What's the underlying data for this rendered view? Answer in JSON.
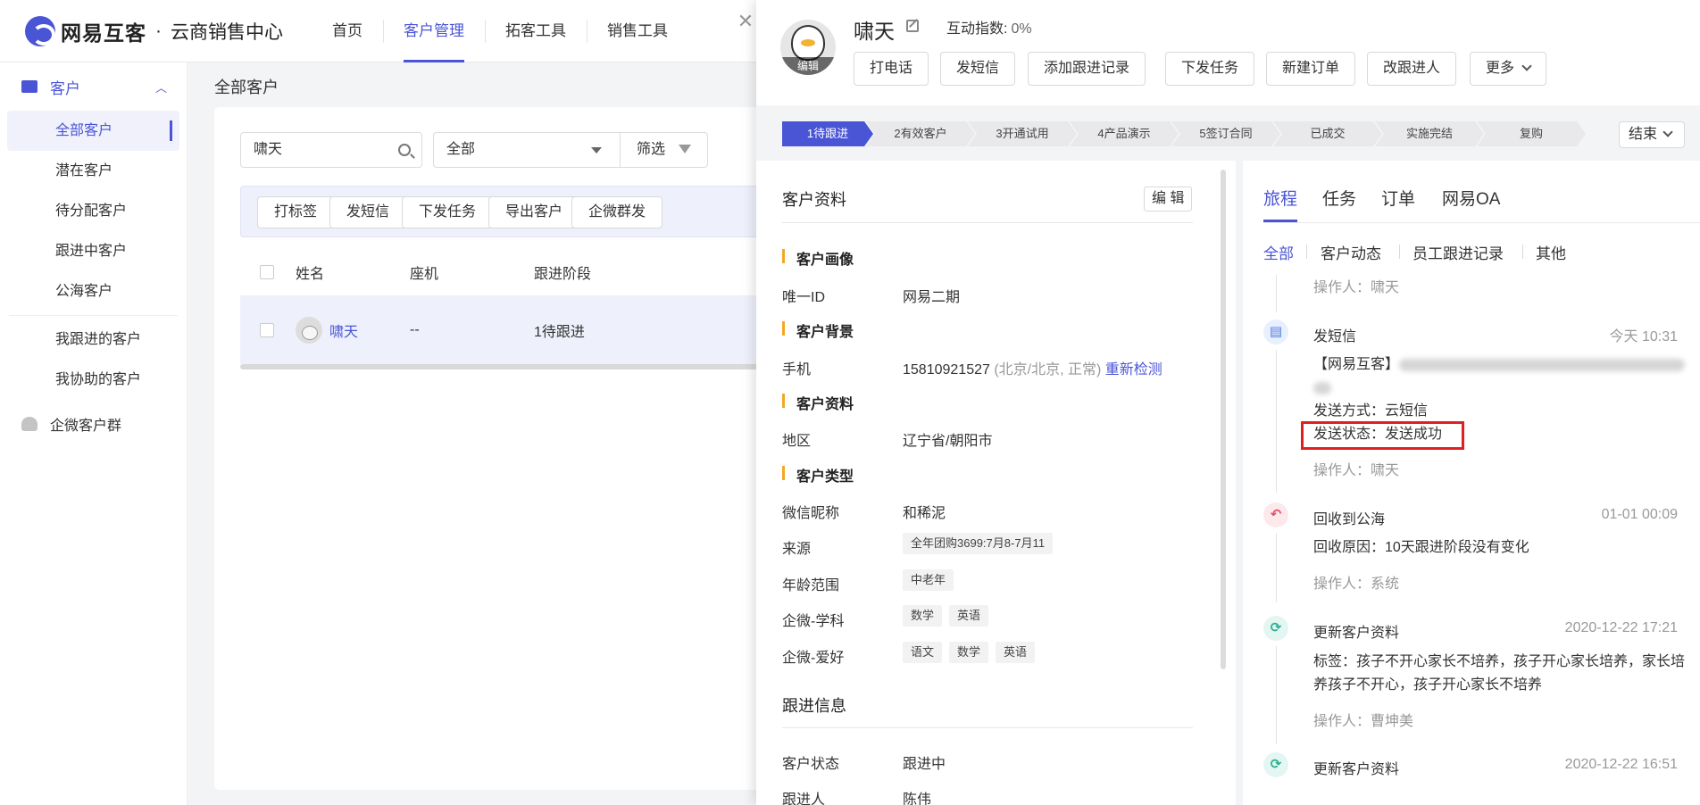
{
  "brand": {
    "name": "网易互客",
    "dot": "·",
    "subtitle": "云商销售中心"
  },
  "topnav": {
    "items": [
      "首页",
      "客户管理",
      "拓客工具",
      "销售工具"
    ],
    "active_index": 1
  },
  "sidebar": {
    "group_label": "客户",
    "items": [
      "全部客户",
      "潜在客户",
      "待分配客户",
      "跟进中客户",
      "公海客户"
    ],
    "items2": [
      "我跟进的客户",
      "我协助的客户"
    ],
    "bottom": "企微客户群",
    "active": "全部客户"
  },
  "main": {
    "breadcrumb": "全部客户",
    "search_value": "啸天",
    "select_value": "全部",
    "filter_label": "筛选",
    "actions": [
      "打标签",
      "发短信",
      "下发任务",
      "导出客户",
      "企微群发"
    ],
    "columns": [
      "姓名",
      "座机",
      "跟进阶段"
    ],
    "row": {
      "name": "啸天",
      "phone": "--",
      "stage": "1待跟进"
    }
  },
  "drawer": {
    "avatar_edit": "编辑",
    "name": "啸天",
    "interaction_label": "互动指数:",
    "interaction_value": "0%",
    "buttons": [
      "打电话",
      "发短信",
      "添加跟进记录",
      "下发任务",
      "新建订单",
      "改跟进人",
      "更多"
    ],
    "stages": [
      "1待跟进",
      "2有效客户",
      "3开通试用",
      "4产品演示",
      "5签订合同",
      "已成交",
      "实施完结",
      "复购"
    ],
    "active_stage": "1待跟进",
    "end_label": "结束"
  },
  "info": {
    "title": "客户资料",
    "edit_label": "编 辑",
    "sections": {
      "portrait": "客户画像",
      "background": "客户背景",
      "profile": "客户资料",
      "type": "客户类型"
    },
    "uid_label": "唯一ID",
    "uid_value": "网易二期",
    "phone_label": "手机",
    "phone_value": "15810921527",
    "phone_extra": "(北京/北京, 正常)",
    "phone_action": "重新检测",
    "region_label": "地区",
    "region_value": "辽宁省/朝阳市",
    "wechat_label": "微信昵称",
    "wechat_value": "和稀泥",
    "source_label": "来源",
    "source_tag": "全年团购3699:7月8-7月11",
    "age_label": "年龄范围",
    "age_tag": "中老年",
    "subject_label": "企微-学科",
    "subject_tags": [
      "数学",
      "英语"
    ],
    "hobby_label": "企微-爱好",
    "hobby_tags": [
      "语文",
      "数学",
      "英语"
    ],
    "follow_title": "跟进信息",
    "status_label": "客户状态",
    "status_value": "跟进中",
    "owner_label": "跟进人",
    "owner_value": "陈伟"
  },
  "timeline": {
    "tabs": [
      "旅程",
      "任务",
      "订单",
      "网易OA"
    ],
    "filters": [
      "全部",
      "客户动态",
      "员工跟进记录",
      "其他"
    ],
    "top_operator": "操作人：啸天",
    "events": [
      {
        "icon": "message-icon",
        "title": "发短信",
        "time": "今天 10:31",
        "content_prefix": "【网易互客】",
        "method": "发送方式：云短信",
        "status": "发送状态：发送成功",
        "operator": "操作人：啸天"
      },
      {
        "icon": "recycle-icon",
        "title": "回收到公海",
        "time": "01-01 00:09",
        "reason": "回收原因：10天跟进阶段没有变化",
        "operator": "操作人：系统"
      },
      {
        "icon": "refresh-icon",
        "title": "更新客户资料",
        "time": "2020-12-22 17:21",
        "detail": "标签：孩子不开心家长不培养，孩子开心家长培养，家长培养孩子不开心，孩子开心家长不培养",
        "operator": "操作人：曹坤美"
      },
      {
        "icon": "refresh-icon",
        "title": "更新客户资料",
        "time": "2020-12-22 16:51"
      }
    ]
  },
  "colors": {
    "accent": "#4a55d6",
    "highlight": "#e02020",
    "tag_orange": "#f5a623"
  }
}
